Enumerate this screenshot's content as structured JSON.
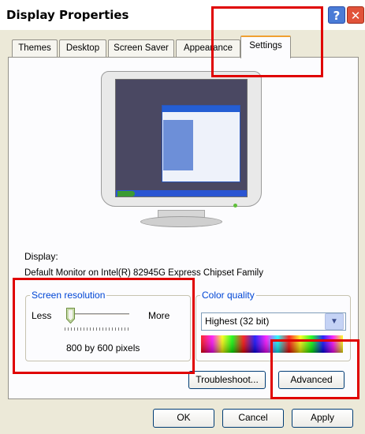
{
  "window": {
    "title": "Display Properties",
    "help_glyph": "?",
    "close_glyph": "✕"
  },
  "tabs": [
    {
      "label": "Themes",
      "active": false
    },
    {
      "label": "Desktop",
      "active": false
    },
    {
      "label": "Screen Saver",
      "active": false
    },
    {
      "label": "Appearance",
      "active": false
    },
    {
      "label": "Settings",
      "active": true
    }
  ],
  "display": {
    "label": "Display:",
    "device": "Default Monitor on Intel(R) 82945G Express Chipset Family"
  },
  "screen_resolution": {
    "legend": "Screen resolution",
    "less_label": "Less",
    "more_label": "More",
    "value_text": "800 by 600 pixels",
    "slider_position": 0
  },
  "color_quality": {
    "legend": "Color quality",
    "selected": "Highest (32 bit)"
  },
  "buttons": {
    "troubleshoot": "Troubleshoot...",
    "advanced": "Advanced",
    "ok": "OK",
    "cancel": "Cancel",
    "apply": "Apply"
  },
  "icons": {
    "help": "help-icon",
    "close": "close-icon",
    "dropdown": "chevron-down-icon",
    "monitor": "monitor-preview-icon"
  },
  "colors": {
    "accent": "#0046d5",
    "annotation": "#e00000",
    "tab_highlight": "#f0a030"
  }
}
